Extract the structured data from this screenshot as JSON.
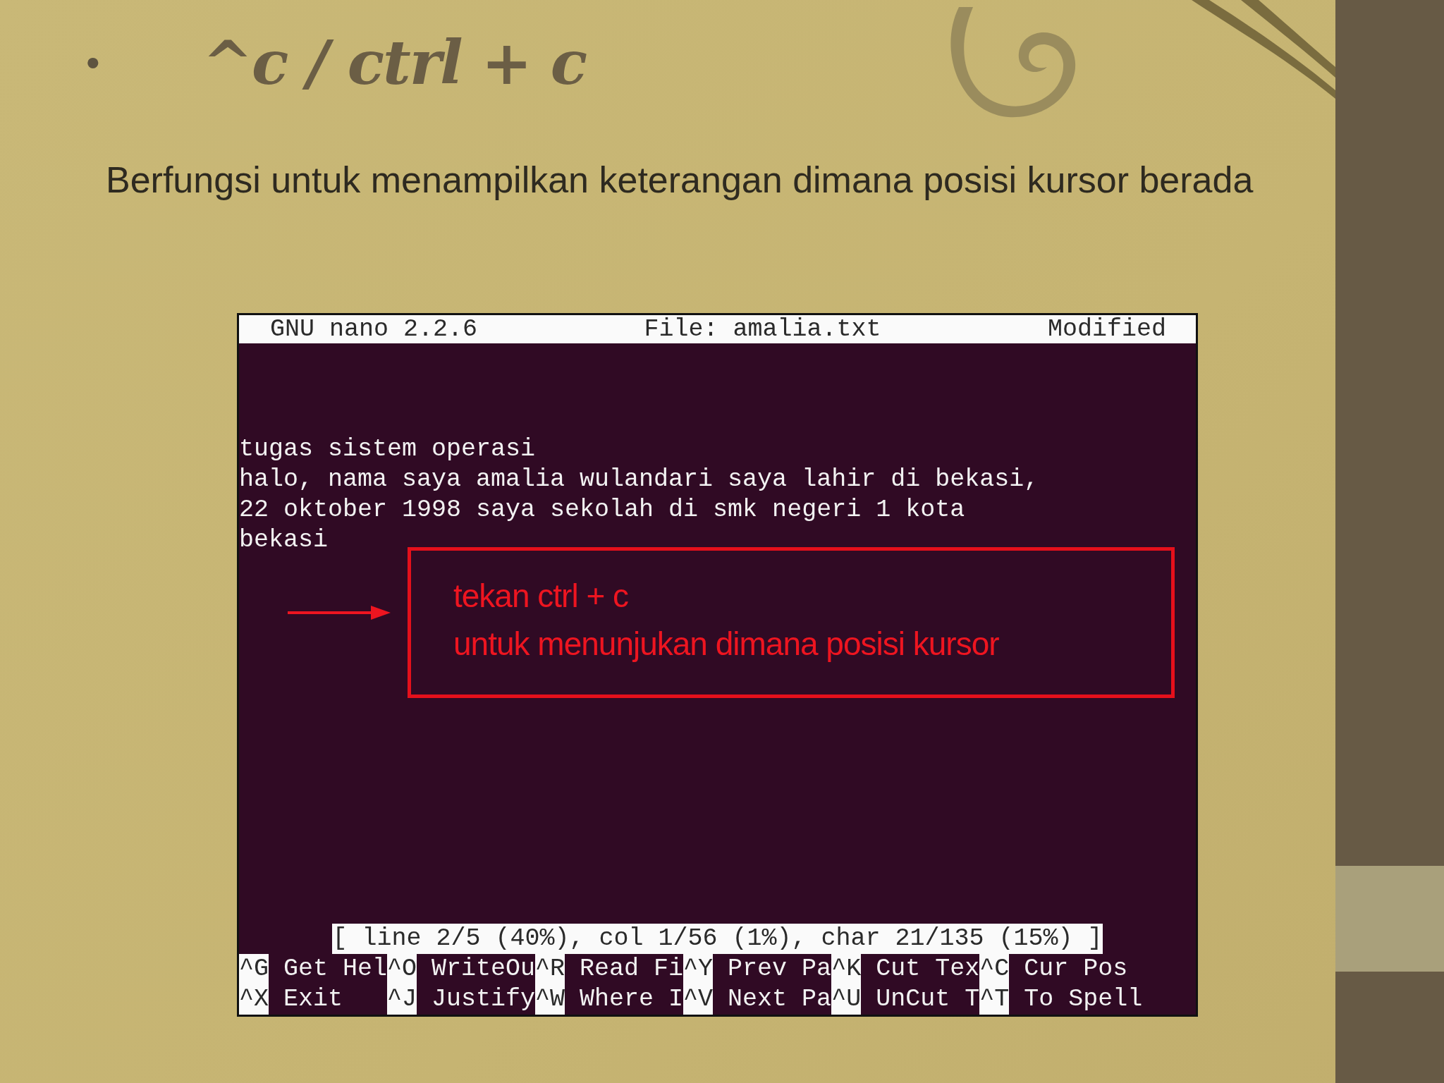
{
  "slide": {
    "bullet": "•",
    "title": "^c / ctrl + c",
    "body": "Berfungsi untuk menampilkan keterangan dimana posisi kursor berada"
  },
  "terminal": {
    "header": {
      "app": "GNU nano 2.2.6",
      "file": "File: amalia.txt",
      "status": "Modified"
    },
    "lines": [
      "tugas sistem operasi",
      "halo, nama saya amalia wulandari saya lahir di bekasi,",
      "22 oktober 1998 saya sekolah di smk negeri 1 kota",
      "bekasi"
    ],
    "status_message": "[ line 2/5 (40%), col 1/56 (1%), char 21/135 (15%) ]",
    "shortcuts": [
      [
        {
          "key": "^G",
          "label": "Get Hel"
        },
        {
          "key": "^O",
          "label": "WriteOu"
        },
        {
          "key": "^R",
          "label": "Read Fi"
        },
        {
          "key": "^Y",
          "label": "Prev Pa"
        },
        {
          "key": "^K",
          "label": "Cut Tex"
        },
        {
          "key": "^C",
          "label": "Cur Pos"
        }
      ],
      [
        {
          "key": "^X",
          "label": "Exit"
        },
        {
          "key": "^J",
          "label": "Justify"
        },
        {
          "key": "^W",
          "label": "Where I"
        },
        {
          "key": "^V",
          "label": "Next Pa"
        },
        {
          "key": "^U",
          "label": "UnCut T"
        },
        {
          "key": "^T",
          "label": "To Spell"
        }
      ]
    ]
  },
  "callout": {
    "lines": [
      "tekan ctrl + c",
      "untuk menunjukan dimana posisi kursor"
    ]
  }
}
